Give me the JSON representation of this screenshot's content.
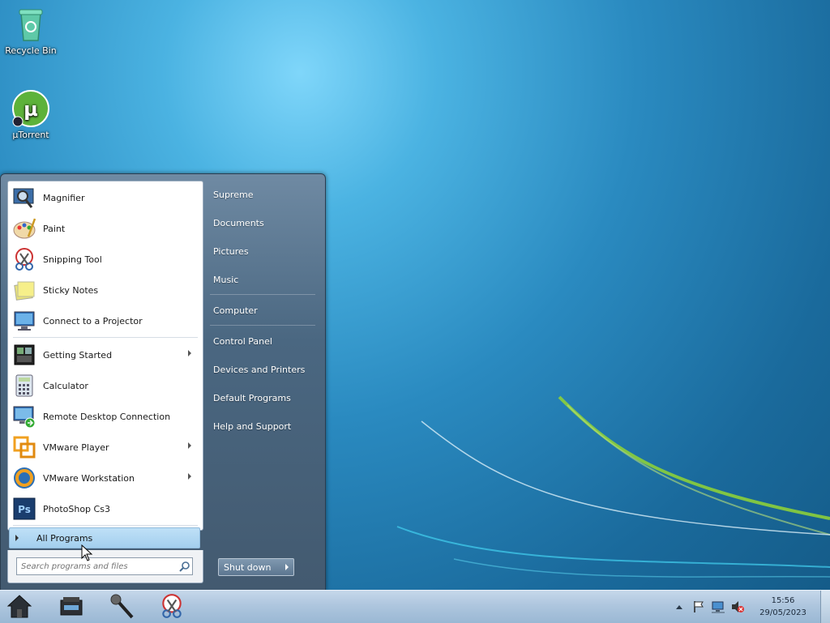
{
  "desktop": {
    "icons": [
      {
        "label": "Recycle Bin",
        "icon": "recycle-bin-icon"
      },
      {
        "label": "µTorrent",
        "icon": "utorrent-icon"
      }
    ]
  },
  "start_menu": {
    "programs": [
      {
        "label": "Magnifier",
        "icon": "magnifier-icon",
        "submenu": false
      },
      {
        "label": "Paint",
        "icon": "paint-icon",
        "submenu": false
      },
      {
        "label": "Snipping Tool",
        "icon": "snipping-tool-icon",
        "submenu": false
      },
      {
        "label": "Sticky Notes",
        "icon": "sticky-notes-icon",
        "submenu": false
      },
      {
        "label": "Connect to a Projector",
        "icon": "projector-icon",
        "submenu": false
      },
      {
        "label": "Getting Started",
        "icon": "getting-started-icon",
        "submenu": true
      },
      {
        "label": "Calculator",
        "icon": "calculator-icon",
        "submenu": false
      },
      {
        "label": "Remote Desktop Connection",
        "icon": "remote-desktop-icon",
        "submenu": false
      },
      {
        "label": "VMware Player",
        "icon": "vmware-player-icon",
        "submenu": true
      },
      {
        "label": "VMware Workstation",
        "icon": "vmware-workstation-icon",
        "submenu": true
      },
      {
        "label": "PhotoShop Cs3",
        "icon": "photoshop-icon",
        "submenu": false
      }
    ],
    "all_programs_label": "All Programs",
    "search_placeholder": "Search programs and files",
    "right_items": [
      {
        "label": "Supreme"
      },
      {
        "label": "Documents"
      },
      {
        "label": "Pictures"
      },
      {
        "label": "Music"
      },
      {
        "label": "Computer"
      },
      {
        "label": "Control Panel"
      },
      {
        "label": "Devices and Printers"
      },
      {
        "label": "Default Programs"
      },
      {
        "label": "Help and Support"
      }
    ],
    "shutdown_label": "Shut down"
  },
  "taskbar": {
    "pinned": [
      "home-icon",
      "scanner-icon",
      "microphone-icon",
      "snipping-tool-icon"
    ],
    "tray": [
      "show-hidden-icons-chevron",
      "action-center-flag-icon",
      "network-icon",
      "volume-muted-icon"
    ],
    "time": "15:56",
    "date": "29/05/2023"
  },
  "colors": {
    "accent_highlight": "#a3cfee",
    "taskbar": "#aec6de",
    "swoosh_green": "#8ccf3a"
  }
}
